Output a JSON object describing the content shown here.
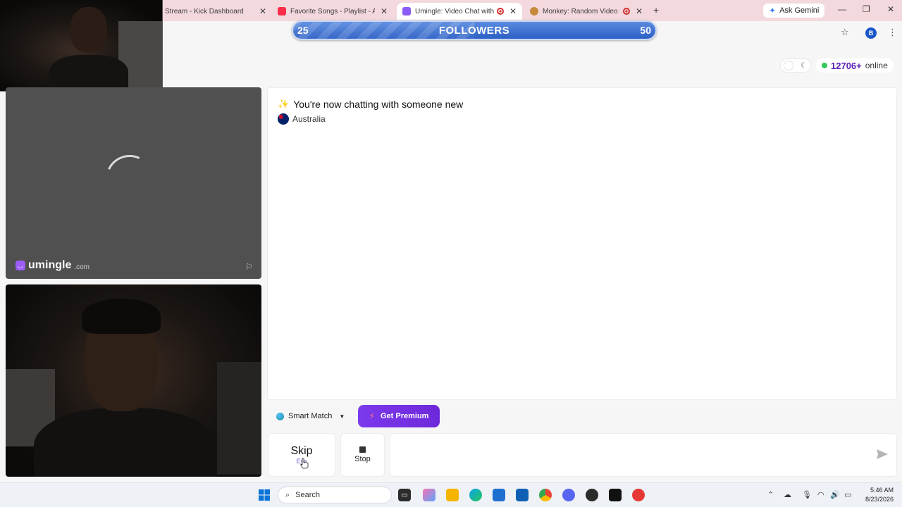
{
  "browser": {
    "tabs": [
      {
        "title": "Stream - Kick Dashboard",
        "favicon_color": "#53fc18",
        "active": false,
        "recording": false
      },
      {
        "title": "Favorite Songs - Playlist - Apple",
        "favicon_color": "#fa2d48",
        "active": false,
        "recording": false
      },
      {
        "title": "Umingle: Video Chat with St",
        "favicon_color": "#8b5cf6",
        "active": true,
        "recording": true
      },
      {
        "title": "Monkey: Random Video Ch",
        "favicon_color": "#c68a3a",
        "active": false,
        "recording": true
      }
    ],
    "new_tab_label": "+",
    "ask_gemini_label": "Ask Gemini",
    "profile_initial": "B"
  },
  "followers_bar": {
    "current": "25",
    "label": "FOLLOWERS",
    "goal": "50",
    "progress_fraction": 0.5,
    "color": "#2b5fc4"
  },
  "status": {
    "online_count": "12706+",
    "online_label": "online",
    "online_color": "#33c759"
  },
  "stranger_panel": {
    "brand_name": "umingle",
    "brand_tld": ".com",
    "brand_color": "#9b5cf6",
    "report_icon": "flag-icon"
  },
  "chat": {
    "system_message": "You're now chatting with someone new",
    "country": "Australia"
  },
  "controls": {
    "smart_match_label": "Smart Match",
    "premium_label": "Get Premium",
    "premium_color": "#7c3aed",
    "skip_label": "Skip",
    "skip_shortcut": "Esc",
    "stop_label": "Stop",
    "message_placeholder": "",
    "send_icon": "send-icon"
  },
  "taskbar": {
    "search_label": "Search",
    "time": "5:46 AM",
    "date": "8/23/2026"
  }
}
